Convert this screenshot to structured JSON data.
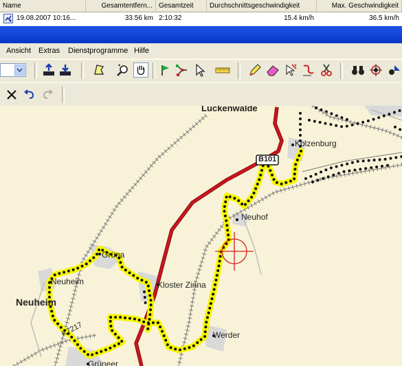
{
  "table": {
    "headers": [
      "Name",
      "Gesamtentfern...",
      "Gesamtzeit",
      "Durchschnittsgeschwindigkeit",
      "Max. Geschwindigkeit"
    ],
    "row": {
      "name": "19.08.2007 10:16...",
      "distance": "33.56 km",
      "time": "2:10:32",
      "avg_speed": "15.4 km/h",
      "max_speed": "36.5 km/h"
    }
  },
  "menu": [
    "Ansicht",
    "Extras",
    "Dienstprogramme",
    "Hilfe"
  ],
  "map": {
    "labels": {
      "luckenwalde": "Luckenwalde",
      "kolzenburg": "Kolzenburg",
      "road_b101": "B101",
      "neuhof": "Neuhof",
      "gruna": "Grüna",
      "neuheim_small": "Neuheim",
      "neuheim_big": "Neuheim",
      "kloster_zinna": "Kloster Zinna",
      "road_k7217": "K7217",
      "werder": "Werder",
      "gruneer": "Grüneer"
    }
  },
  "colors": {
    "track_highlight": "#f6f600",
    "road_major": "#c0141c",
    "cursor": "#d02020",
    "title_band": "#0a3fd6"
  }
}
